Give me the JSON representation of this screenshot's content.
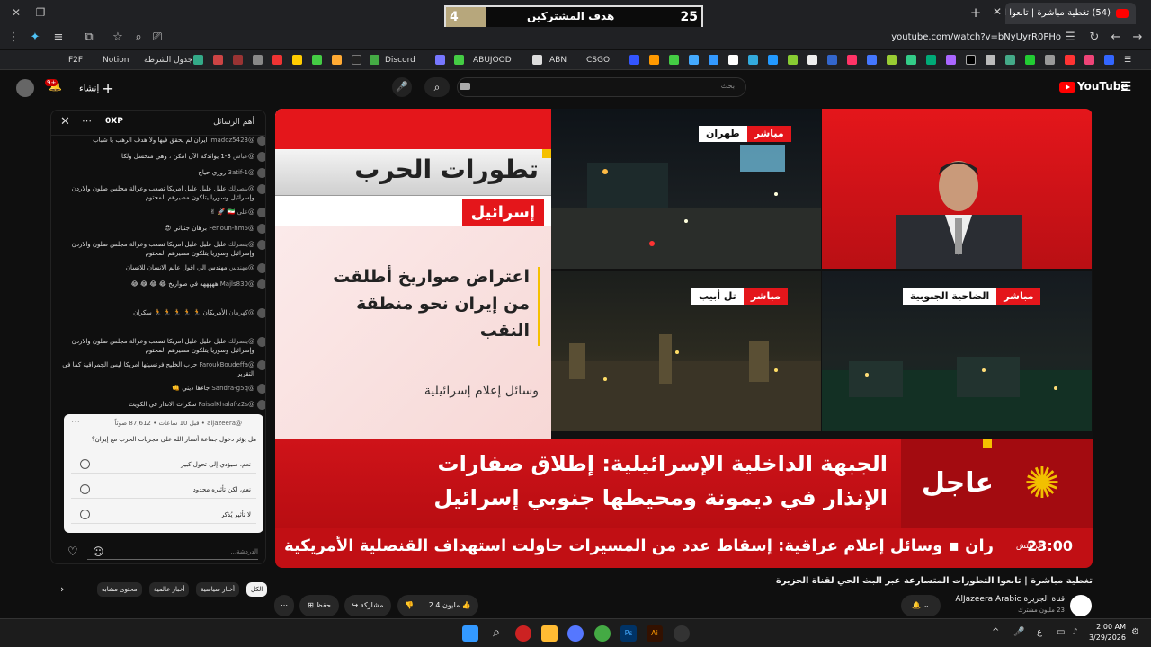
{
  "browser": {
    "tab_title": "(54) تغطية مباشرة | تابعوا ال",
    "url": "youtube.com/watch?v=bNyUyrR0PHo",
    "bookmarks": [
      "F2F",
      "Notion",
      "جدول الشرطة",
      "Discord",
      "ABUJOOD",
      "ABN",
      "CSGO"
    ]
  },
  "sub_goal": {
    "current": "4",
    "label": "هدف المشتركين",
    "target": "25",
    "progress": 0.16
  },
  "youtube": {
    "search_placeholder": "بحث",
    "logo": "YouTube",
    "create_label": "إنشاء",
    "notif_count": "9+"
  },
  "video": {
    "header_title": "تطورات الحرب",
    "header_sub": "إسرائيل",
    "headline": [
      "اعتراض صواريخ أطلقت",
      "من إيران نحو منطقة",
      "النقب"
    ],
    "source": "وسائل إعلام إسرائيلية",
    "cells": [
      {
        "live": "مباشر",
        "place": "طهران"
      },
      {
        "live": "مباشر",
        "place": "تل أبيب"
      },
      {
        "live": "مباشر",
        "place": "الضاحية الجنوبية"
      }
    ],
    "breaking_label": "عاجل",
    "breaking_lines": [
      "الجبهة الداخلية الإسرائيلية: إطلاق صفارات",
      "الإنذار في ديمونة ومحيطها جنوبي إسرائيل"
    ],
    "ticker_time": "23:00",
    "ticker_zone": "غرينتش",
    "ticker_text": "ران  ▪  وسائل إعلام عراقية: إسقاط عدد من المسيرات حاولت استهداف القنصلية الأمريكية"
  },
  "below": {
    "title": "تغطية مباشرة | تابعوا التطورات المتسارعة عبر البث الحي لقناة الجزيرة",
    "channel": "قناة الجزيرة AlJazeera Arabic",
    "subs": "23 مليون مشترك",
    "likes": "2.4 مليون",
    "share": "مشاركة",
    "save": "حفظ"
  },
  "chat": {
    "title": "أهم الرسائل",
    "xp": "0XP",
    "messages": [
      {
        "author": "@imadoz5423",
        "text": "ايران لم يحقق فيها ولا هدف الرهب يا شباب"
      },
      {
        "author": "@عباس",
        "text": "3-1 يوائدكة الآن امكن ، وهي منحسل ولكا"
      },
      {
        "author": "@3atif-1",
        "text": "روزي حياج"
      },
      {
        "author": "@ينصرلك",
        "text": "عليل عليل عليل امريكا تصعب وعرالة مجلس صلون والاردن وإسرائيل وسوريا يتلكون مصيرهم المحتوم"
      },
      {
        "author": "@على",
        "text": "🇮🇷 🚀 ✌"
      },
      {
        "author": "@Fenoun-hm6",
        "text": "برهان جنياني 😍"
      },
      {
        "author": "@ينصرلك",
        "text": "عليل عليل عليل امريكا تصعب وعرالة مجلس صلون والاردن وإسرائيل وسوريا يتلكون مصيرهم المحتوم"
      },
      {
        "author": "@مهندس",
        "text": "مهندس الي اقول عالم الانسان للانسان"
      },
      {
        "author": "@Majls830",
        "text": "هههههه في صواريخ 😂 😂 😂 😂"
      },
      {
        "author": "@كهرمان",
        "text": "الأمريكان 🏃 🏃 🏃 🏃 🏃 سكران"
      },
      {
        "author": "@ينصرلك",
        "text": "عليل عليل عليل امريكا تصعب وعرالة مجلس صلون والاردن وإسرائيل وسوريا يتلكون مصيرهم المحتوم"
      },
      {
        "author": "@FaroukBoudeffa",
        "text": "حرب الخليج فرنسيتها امريكا ليس الجمراقية كما في التقرير"
      },
      {
        "author": "@Sandra-g5q",
        "text": "جاءها ديني 👊"
      },
      {
        "author": "@FaisalKhalaf-z2s",
        "text": "سكرات الانذار في الكويت"
      }
    ],
    "poll": {
      "header": "@aljazeera • قبل 10 ساعات • 87,612 صوتاً",
      "question": "هل يؤثر دخول جماعة أنصار الله على مجريات الحرب مع إيران؟",
      "options": [
        "نعم، سيؤدي إلى تحول كبير",
        "نعم، لكن تأثيره محدود",
        "لا تأثير يُذكر"
      ]
    },
    "input_placeholder": "الدردشة..."
  },
  "chips": [
    "الكل",
    "أخبار سياسية",
    "أخبار عالمية",
    "محتوى مشابه"
  ],
  "taskbar": {
    "time": "2:00 AM",
    "date": "3/29/2026",
    "lang": "ع"
  }
}
